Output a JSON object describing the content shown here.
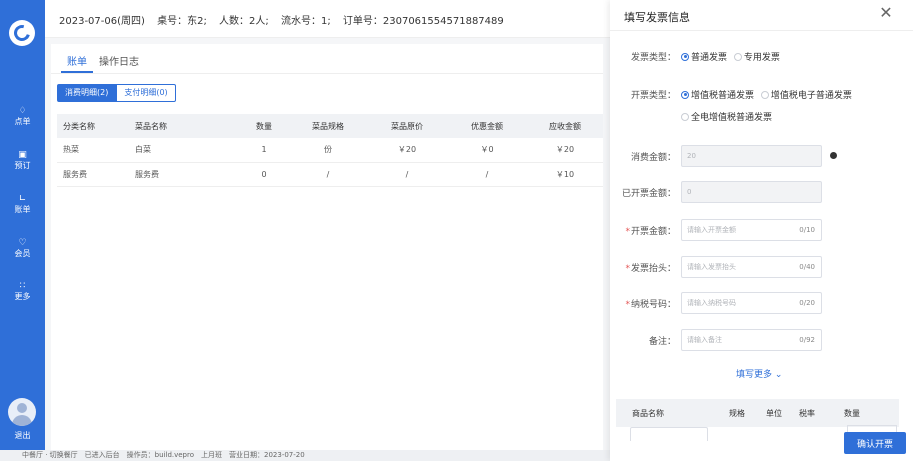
{
  "nav": {
    "items": [
      {
        "label": "点单",
        "icon": "bell-icon"
      },
      {
        "label": "预订",
        "icon": "calendar-icon"
      },
      {
        "label": "账单",
        "icon": "chart-icon"
      },
      {
        "label": "会员",
        "icon": "member-icon"
      },
      {
        "label": "更多",
        "icon": "grid-icon"
      }
    ],
    "logout": "退出"
  },
  "header": {
    "date": "2023-07-06(周四)",
    "table": "桌号：东2;",
    "people": "人数：2人;",
    "serial": "流水号：1;",
    "order": "订单号：2307061554571887489"
  },
  "tabs": [
    "账单",
    "操作日志"
  ],
  "subtabs": [
    "消费明细(2)",
    "支付明细(0)"
  ],
  "table": {
    "headers": [
      "分类名称",
      "菜品名称",
      "数量",
      "菜品规格",
      "菜品原价",
      "优惠金额",
      "应收金额"
    ],
    "rows": [
      [
        "热菜",
        "白菜",
        "1",
        "份",
        "￥20",
        "￥0",
        "￥20"
      ],
      [
        "服务费",
        "服务费",
        "0",
        "/",
        "/",
        "/",
        "￥10"
      ]
    ]
  },
  "bottom_bar": "中餐厅 · 切换餐厅　已进入后台　操作员：build.vepro　上月班　营业日期：2023-07-20",
  "drawer": {
    "title": "填写发票信息",
    "invoice_type": {
      "label": "发票类型：",
      "options": [
        "普通发票",
        "专用发票"
      ],
      "selected": "普通发票"
    },
    "issue_type": {
      "label": "开票类型：",
      "options": [
        "增值税普通发票",
        "增值税电子普通发票",
        "全电增值税普通发票"
      ],
      "selected": "增值税普通发票"
    },
    "consume_amount": {
      "label": "消费金额：",
      "value": "20"
    },
    "issued_amount": {
      "label": "已开票金额：",
      "value": "0"
    },
    "issue_amount": {
      "label": "开票金额：",
      "placeholder": "请输入开票金额",
      "count": "0/10"
    },
    "invoice_title": {
      "label": "发票抬头：",
      "placeholder": "请输入发票抬头",
      "count": "0/40"
    },
    "tax_number": {
      "label": "纳税号码：",
      "placeholder": "请输入纳税号码",
      "count": "0/20"
    },
    "remark": {
      "label": "备注：",
      "placeholder": "请输入备注",
      "count": "0/92"
    },
    "more": "填写更多",
    "goods_headers": [
      "商品名称",
      "规格",
      "单位",
      "税率",
      "数量"
    ],
    "confirm": "确认开票"
  },
  "colors": {
    "primary": "#2f6fd8",
    "required": "#e45656"
  }
}
